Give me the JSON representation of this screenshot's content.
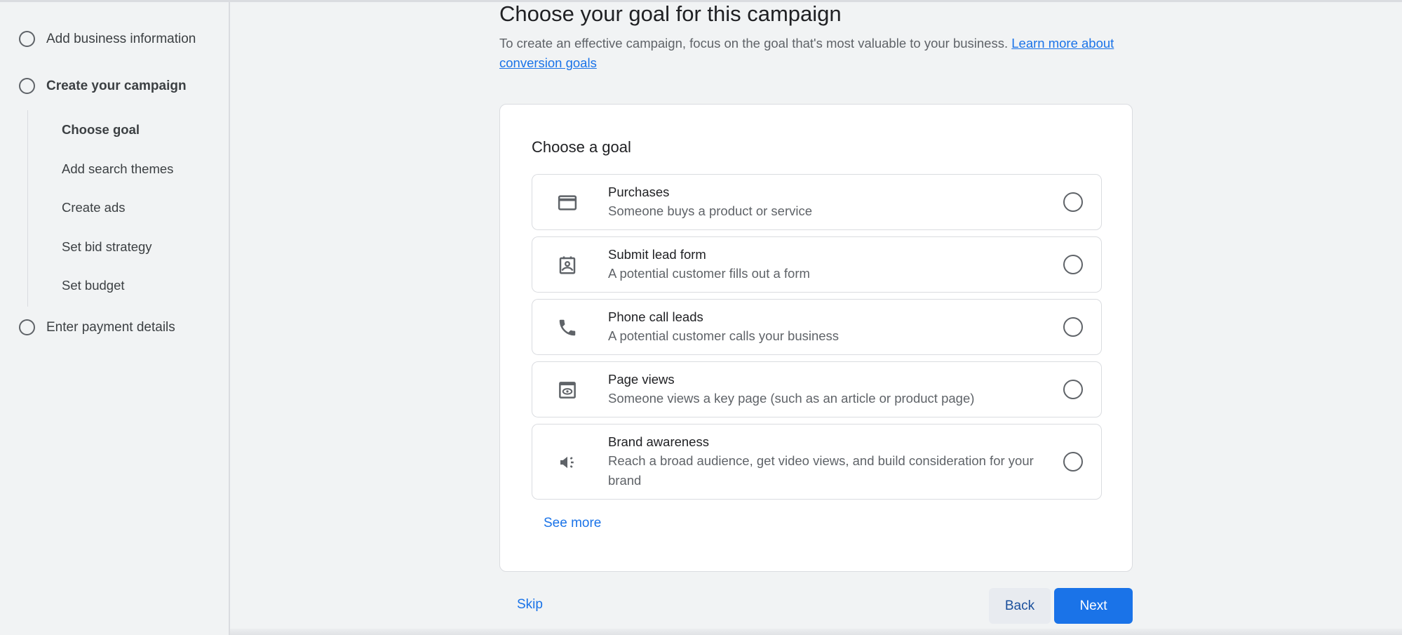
{
  "sidebar": {
    "steps": [
      {
        "label": "Add business information"
      },
      {
        "label": "Create your campaign"
      },
      {
        "label": "Enter payment details"
      }
    ],
    "substeps": [
      {
        "label": "Choose goal",
        "active": true
      },
      {
        "label": "Add search themes"
      },
      {
        "label": "Create ads"
      },
      {
        "label": "Set bid strategy"
      },
      {
        "label": "Set budget"
      }
    ]
  },
  "main": {
    "title": "Choose your goal for this campaign",
    "description": "To create an effective campaign, focus on the goal that's most valuable to your business. ",
    "learn_more_link": "Learn more about conversion goals",
    "card": {
      "title": "Choose a goal",
      "options": [
        {
          "icon": "credit-card-icon",
          "title": "Purchases",
          "desc": "Someone buys a product or service",
          "selected": false
        },
        {
          "icon": "contact-form-icon",
          "title": "Submit lead form",
          "desc": "A potential customer fills out a form",
          "selected": false
        },
        {
          "icon": "phone-icon",
          "title": "Phone call leads",
          "desc": "A potential customer calls your business",
          "selected": false
        },
        {
          "icon": "page-view-icon",
          "title": "Page views",
          "desc": "Someone views a key page (such as an article or product page)",
          "selected": false
        },
        {
          "icon": "megaphone-icon",
          "title": "Brand awareness",
          "desc": "Reach a broad audience, get video views, and build consideration for your brand",
          "selected": false
        }
      ],
      "see_more": "See more"
    },
    "footer": {
      "skip": "Skip",
      "back": "Back",
      "next": "Next"
    }
  },
  "colors": {
    "accent": "#1a73e8",
    "background": "#f1f3f4",
    "card": "#ffffff"
  }
}
